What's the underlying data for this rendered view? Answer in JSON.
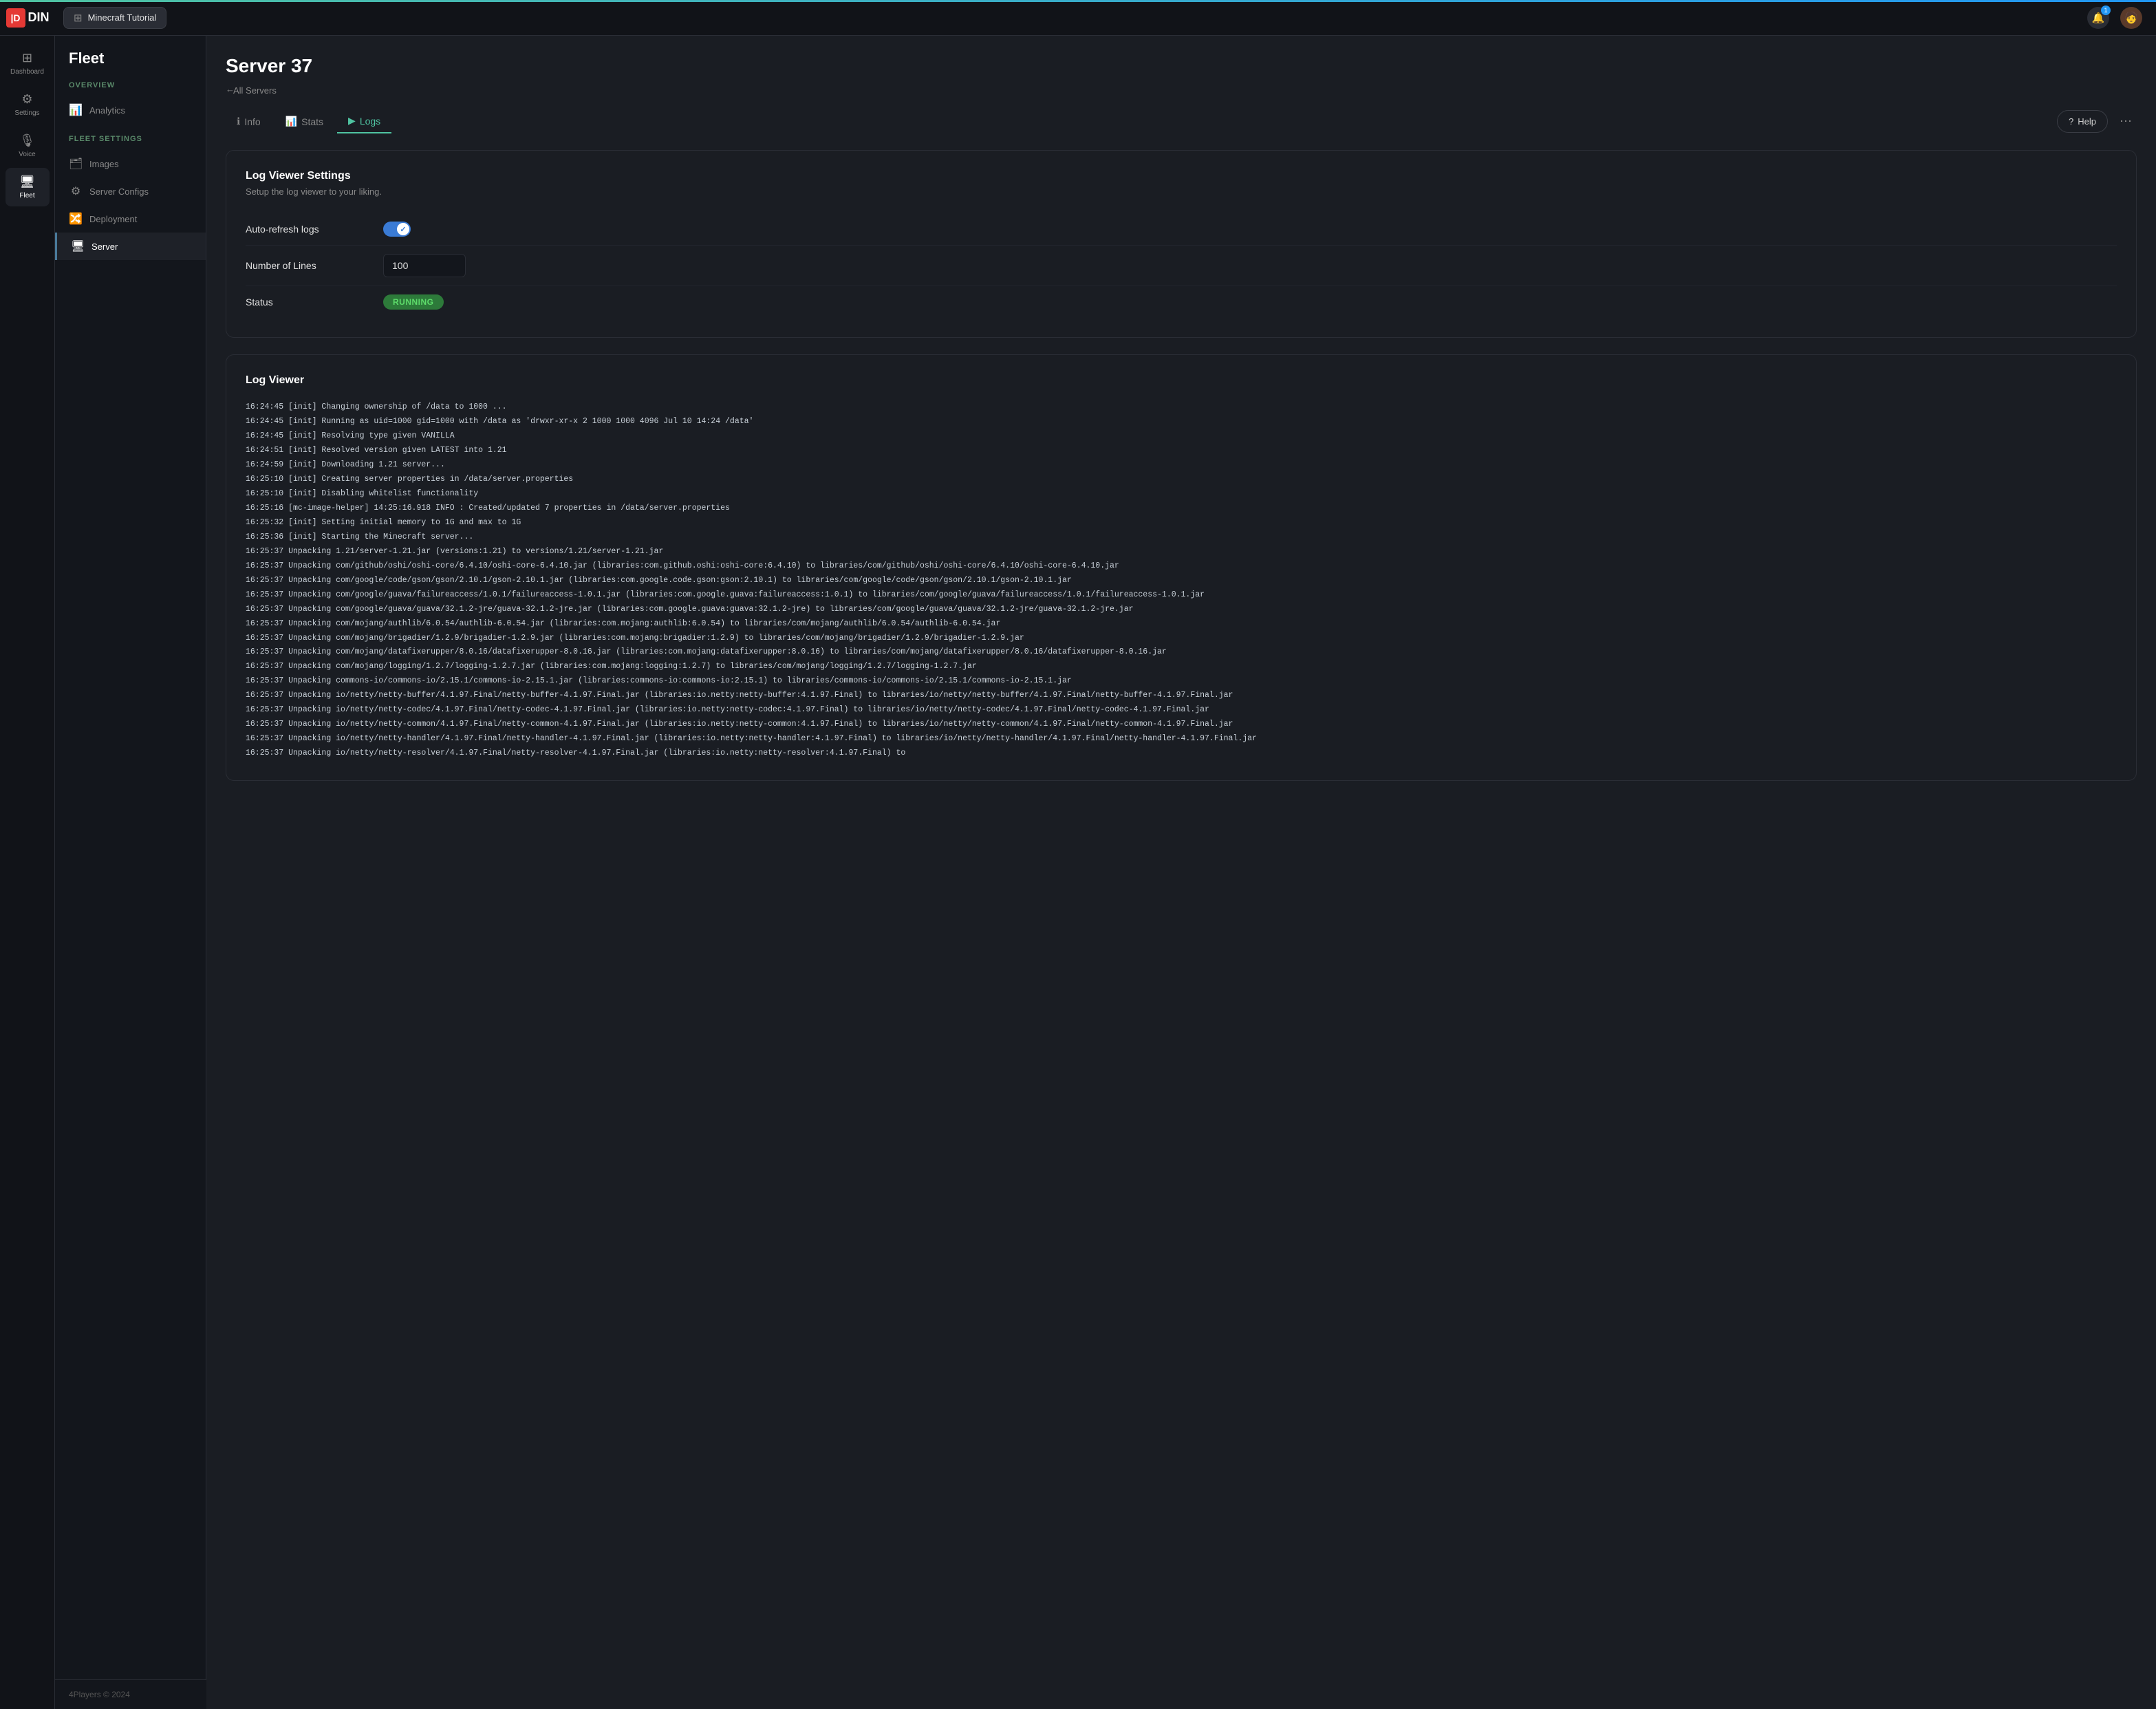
{
  "topbar": {
    "logo_text": "DIN",
    "project_label": "Minecraft Tutorial",
    "bell_badge": "1"
  },
  "sidebar_nav": [
    {
      "id": "dashboard",
      "label": "Dashboard",
      "icon": "⊞",
      "active": false
    },
    {
      "id": "settings",
      "label": "Settings",
      "icon": "⚙",
      "active": false
    },
    {
      "id": "voice",
      "label": "Voice",
      "icon": "🎙",
      "active": false
    },
    {
      "id": "fleet",
      "label": "Fleet",
      "icon": "🖥",
      "active": true
    }
  ],
  "left_panel": {
    "title": "Fleet",
    "sections": [
      {
        "label": "OVERVIEW",
        "items": [
          {
            "id": "analytics",
            "label": "Analytics",
            "icon": "📊"
          }
        ]
      },
      {
        "label": "FLEET SETTINGS",
        "items": [
          {
            "id": "images",
            "label": "Images",
            "icon": "🗂"
          },
          {
            "id": "server-configs",
            "label": "Server Configs",
            "icon": "⚙"
          },
          {
            "id": "deployment",
            "label": "Deployment",
            "icon": "🔀"
          },
          {
            "id": "server",
            "label": "Server",
            "icon": "🖥",
            "active": true
          }
        ]
      }
    ]
  },
  "server": {
    "title": "Server 37",
    "back_label": "All Servers",
    "tabs": [
      {
        "id": "info",
        "label": "Info",
        "icon": "ℹ",
        "active": false
      },
      {
        "id": "stats",
        "label": "Stats",
        "icon": "📊",
        "active": false
      },
      {
        "id": "logs",
        "label": "Logs",
        "icon": "▶",
        "active": true
      }
    ],
    "help_label": "Help",
    "settings_card": {
      "title": "Log Viewer Settings",
      "subtitle": "Setup the log viewer to your liking.",
      "rows": [
        {
          "label": "Auto-refresh logs",
          "type": "toggle",
          "value": true
        },
        {
          "label": "Number of Lines",
          "type": "number",
          "value": "100"
        },
        {
          "label": "Status",
          "type": "badge",
          "value": "RUNNING"
        }
      ]
    },
    "log_viewer": {
      "title": "Log Viewer",
      "lines": [
        "16:24:45 [init] Changing ownership of /data to 1000 ...",
        "16:24:45 [init] Running as uid=1000 gid=1000 with /data as 'drwxr-xr-x 2 1000 1000 4096 Jul 10 14:24 /data'",
        "16:24:45 [init] Resolving type given VANILLA",
        "16:24:51 [init] Resolved version given LATEST into 1.21",
        "16:24:59 [init] Downloading 1.21 server...",
        "16:25:10 [init] Creating server properties in /data/server.properties",
        "16:25:10 [init] Disabling whitelist functionality",
        "16:25:16 [mc-image-helper] 14:25:16.918 INFO : Created/updated 7 properties in /data/server.properties",
        "16:25:32 [init] Setting initial memory to 1G and max to 1G",
        "16:25:36 [init] Starting the Minecraft server...",
        "16:25:37 Unpacking 1.21/server-1.21.jar (versions:1.21) to versions/1.21/server-1.21.jar",
        "16:25:37 Unpacking com/github/oshi/oshi-core/6.4.10/oshi-core-6.4.10.jar (libraries:com.github.oshi:oshi-core:6.4.10) to libraries/com/github/oshi/oshi-core/6.4.10/oshi-core-6.4.10.jar",
        "16:25:37 Unpacking com/google/code/gson/gson/2.10.1/gson-2.10.1.jar (libraries:com.google.code.gson:gson:2.10.1) to libraries/com/google/code/gson/gson/2.10.1/gson-2.10.1.jar",
        "16:25:37 Unpacking com/google/guava/failureaccess/1.0.1/failureaccess-1.0.1.jar (libraries:com.google.guava:failureaccess:1.0.1) to libraries/com/google/guava/failureaccess/1.0.1/failureaccess-1.0.1.jar",
        "16:25:37 Unpacking com/google/guava/guava/32.1.2-jre/guava-32.1.2-jre.jar (libraries:com.google.guava:guava:32.1.2-jre) to libraries/com/google/guava/guava/32.1.2-jre/guava-32.1.2-jre.jar",
        "16:25:37 Unpacking com/mojang/authlib/6.0.54/authlib-6.0.54.jar (libraries:com.mojang:authlib:6.0.54) to libraries/com/mojang/authlib/6.0.54/authlib-6.0.54.jar",
        "16:25:37 Unpacking com/mojang/brigadier/1.2.9/brigadier-1.2.9.jar (libraries:com.mojang:brigadier:1.2.9) to libraries/com/mojang/brigadier/1.2.9/brigadier-1.2.9.jar",
        "16:25:37 Unpacking com/mojang/datafixerupper/8.0.16/datafixerupper-8.0.16.jar (libraries:com.mojang:datafixerupper:8.0.16) to libraries/com/mojang/datafixerupper/8.0.16/datafixerupper-8.0.16.jar",
        "16:25:37 Unpacking com/mojang/logging/1.2.7/logging-1.2.7.jar (libraries:com.mojang:logging:1.2.7) to libraries/com/mojang/logging/1.2.7/logging-1.2.7.jar",
        "16:25:37 Unpacking commons-io/commons-io/2.15.1/commons-io-2.15.1.jar (libraries:commons-io:commons-io:2.15.1) to libraries/commons-io/commons-io/2.15.1/commons-io-2.15.1.jar",
        "16:25:37 Unpacking io/netty/netty-buffer/4.1.97.Final/netty-buffer-4.1.97.Final.jar (libraries:io.netty:netty-buffer:4.1.97.Final) to libraries/io/netty/netty-buffer/4.1.97.Final/netty-buffer-4.1.97.Final.jar",
        "16:25:37 Unpacking io/netty/netty-codec/4.1.97.Final/netty-codec-4.1.97.Final.jar (libraries:io.netty:netty-codec:4.1.97.Final) to libraries/io/netty/netty-codec/4.1.97.Final/netty-codec-4.1.97.Final.jar",
        "16:25:37 Unpacking io/netty/netty-common/4.1.97.Final/netty-common-4.1.97.Final.jar (libraries:io.netty:netty-common:4.1.97.Final) to libraries/io/netty/netty-common/4.1.97.Final/netty-common-4.1.97.Final.jar",
        "16:25:37 Unpacking io/netty/netty-handler/4.1.97.Final/netty-handler-4.1.97.Final.jar (libraries:io.netty:netty-handler:4.1.97.Final) to libraries/io/netty/netty-handler/4.1.97.Final/netty-handler-4.1.97.Final.jar",
        "16:25:37 Unpacking io/netty/netty-resolver/4.1.97.Final/netty-resolver-4.1.97.Final.jar (libraries:io.netty:netty-resolver:4.1.97.Final) to"
      ]
    }
  },
  "footer": {
    "text": "4Players © 2024"
  }
}
